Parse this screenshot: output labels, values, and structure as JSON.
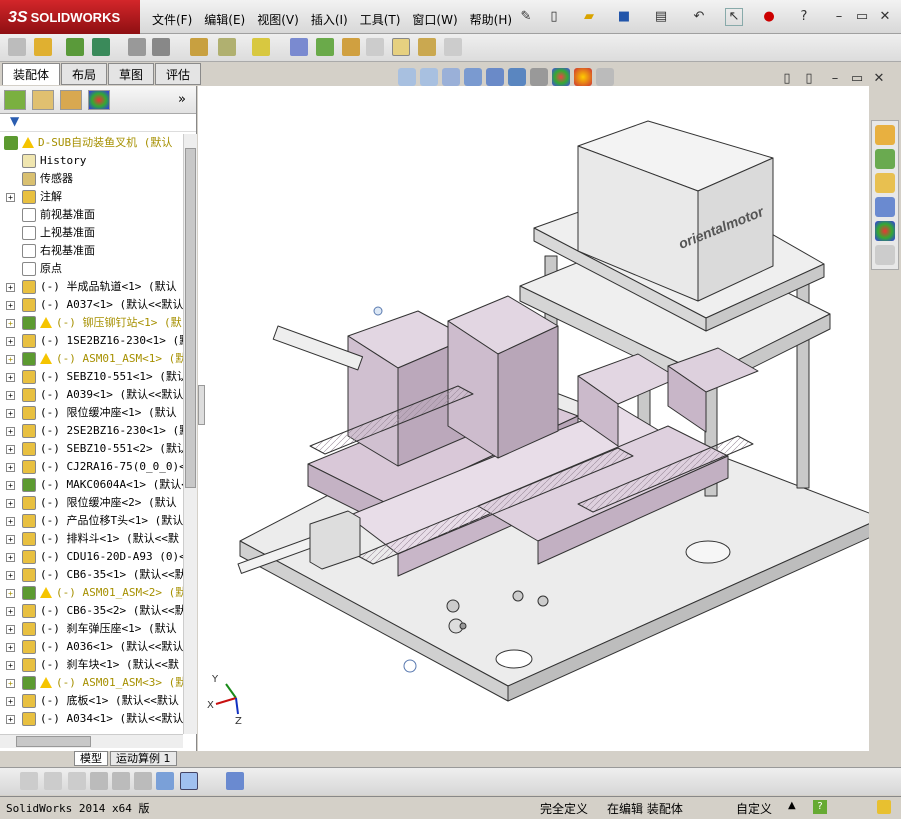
{
  "app": {
    "brand_prefix": "3S",
    "brand": "SOLIDWORKS"
  },
  "menus": [
    "文件(F)",
    "编辑(E)",
    "视图(V)",
    "插入(I)",
    "工具(T)",
    "窗口(W)",
    "帮助(H)"
  ],
  "command_tabs": [
    "装配体",
    "布局",
    "草图",
    "评估"
  ],
  "tree": {
    "root": "D-SUB自动装鱼叉机  (默认",
    "items": [
      {
        "label": "History",
        "kind": "history"
      },
      {
        "label": "传感器",
        "kind": "sensor"
      },
      {
        "label": "注解",
        "kind": "annotation"
      },
      {
        "label": "前视基准面",
        "kind": "plane"
      },
      {
        "label": "上视基准面",
        "kind": "plane"
      },
      {
        "label": "右视基准面",
        "kind": "plane"
      },
      {
        "label": "原点",
        "kind": "origin"
      },
      {
        "label": "(-) 半成品轨道<1> (默认",
        "kind": "part"
      },
      {
        "label": "(-) A037<1> (默认<<默认",
        "kind": "part"
      },
      {
        "label": "(-) 铆压铆钉站<1> (默",
        "kind": "asm-warn"
      },
      {
        "label": "(-) 1SE2BZ16-230<1> (默",
        "kind": "part"
      },
      {
        "label": "(-) ASM01_ASM<1> (默",
        "kind": "asm-warn"
      },
      {
        "label": "(-) SEBZ10-551<1> (默认",
        "kind": "part"
      },
      {
        "label": "(-) A039<1> (默认<<默认",
        "kind": "part"
      },
      {
        "label": "(-) 限位缓冲座<1> (默认",
        "kind": "part"
      },
      {
        "label": "(-) 2SE2BZ16-230<1> (默",
        "kind": "part"
      },
      {
        "label": "(-) SEBZ10-551<2> (默认",
        "kind": "part"
      },
      {
        "label": "(-) CJ2RA16-75(0_0_0)<1",
        "kind": "part"
      },
      {
        "label": "(-) MAKC0604A<1> (默认<",
        "kind": "asm"
      },
      {
        "label": "(-) 限位缓冲座<2> (默认",
        "kind": "part"
      },
      {
        "label": "(-) 产品位移T头<1> (默认",
        "kind": "part"
      },
      {
        "label": "(-) 排料斗<1> (默认<<默",
        "kind": "part"
      },
      {
        "label": "(-) CDU16-20D-A93 (0)<1",
        "kind": "part"
      },
      {
        "label": "(-) CB6-35<1> (默认<<默",
        "kind": "part"
      },
      {
        "label": "(-) ASM01_ASM<2> (默",
        "kind": "asm-warn"
      },
      {
        "label": "(-) CB6-35<2> (默认<<默",
        "kind": "part"
      },
      {
        "label": "(-) 刹车弹压座<1> (默认",
        "kind": "part"
      },
      {
        "label": "(-) A036<1> (默认<<默认",
        "kind": "part"
      },
      {
        "label": "(-) 刹车块<1> (默认<<默",
        "kind": "part"
      },
      {
        "label": "(-) ASM01_ASM<3> (默",
        "kind": "asm-warn"
      },
      {
        "label": "(-) 底板<1> (默认<<默认",
        "kind": "part"
      },
      {
        "label": "(-) A034<1> (默认<<默认",
        "kind": "part"
      }
    ]
  },
  "bottom_tabs": [
    "模型",
    "运动算例 1"
  ],
  "motor_label": "orientalmotor",
  "triad": {
    "x": "X",
    "y": "Y",
    "z": "Z"
  },
  "status": {
    "version": "SolidWorks 2014 x64 版",
    "defined": "完全定义",
    "editing": "在编辑 装配体",
    "custom": "自定义",
    "help": "?"
  },
  "colors": {
    "part": "#d8c8d8",
    "frame": "#e8e8e8",
    "accent": "#c8102e"
  }
}
